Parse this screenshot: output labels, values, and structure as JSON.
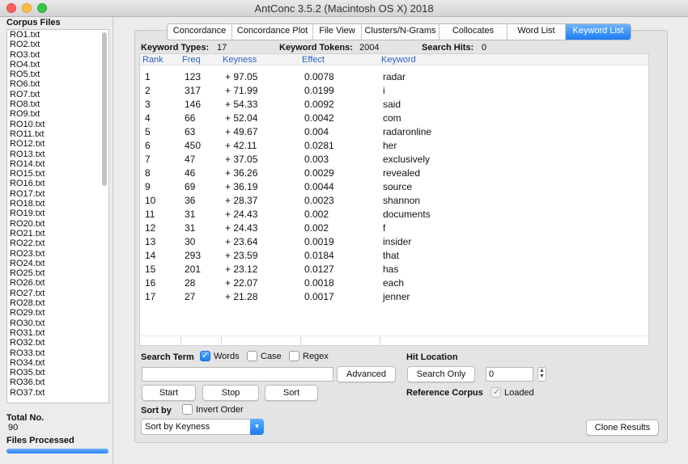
{
  "window": {
    "title": "AntConc 3.5.2 (Macintosh OS X) 2018"
  },
  "sidebar": {
    "corpus_heading": "Corpus Files",
    "files": [
      "RO1.txt",
      "RO2.txt",
      "RO3.txt",
      "RO4.txt",
      "RO5.txt",
      "RO6.txt",
      "RO7.txt",
      "RO8.txt",
      "RO9.txt",
      "RO10.txt",
      "RO11.txt",
      "RO12.txt",
      "RO13.txt",
      "RO14.txt",
      "RO15.txt",
      "RO16.txt",
      "RO17.txt",
      "RO18.txt",
      "RO19.txt",
      "RO20.txt",
      "RO21.txt",
      "RO22.txt",
      "RO23.txt",
      "RO24.txt",
      "RO25.txt",
      "RO26.txt",
      "RO27.txt",
      "RO28.txt",
      "RO29.txt",
      "RO30.txt",
      "RO31.txt",
      "RO32.txt",
      "RO33.txt",
      "RO34.txt",
      "RO35.txt",
      "RO36.txt",
      "RO37.txt"
    ],
    "total_label": "Total No.",
    "total_value": "90",
    "processed_label": "Files Processed",
    "progress_fraction": 1.0
  },
  "tabs": [
    {
      "label": "Concordance",
      "active": false
    },
    {
      "label": "Concordance Plot",
      "active": false
    },
    {
      "label": "File View",
      "active": false
    },
    {
      "label": "Clusters/N-Grams",
      "active": false
    },
    {
      "label": "Collocates",
      "active": false
    },
    {
      "label": "Word List",
      "active": false
    },
    {
      "label": "Keyword List",
      "active": true
    }
  ],
  "stats": {
    "types_label": "Keyword Types:",
    "types_value": "17",
    "tokens_label": "Keyword Tokens:",
    "tokens_value": "2004",
    "hits_label": "Search Hits:",
    "hits_value": "0"
  },
  "table": {
    "headers": {
      "rank": "Rank",
      "freq": "Freq",
      "keyness": "Keyness",
      "effect": "Effect",
      "keyword": "Keyword"
    },
    "rows": [
      {
        "rank": "1",
        "freq": "123",
        "keyness": "+ 97.05",
        "effect": "0.0078",
        "keyword": "radar"
      },
      {
        "rank": "2",
        "freq": "317",
        "keyness": "+ 71.99",
        "effect": "0.0199",
        "keyword": "i"
      },
      {
        "rank": "3",
        "freq": "146",
        "keyness": "+ 54.33",
        "effect": "0.0092",
        "keyword": "said"
      },
      {
        "rank": "4",
        "freq": "66",
        "keyness": "+ 52.04",
        "effect": "0.0042",
        "keyword": "com"
      },
      {
        "rank": "5",
        "freq": "63",
        "keyness": "+ 49.67",
        "effect": "0.004",
        "keyword": "radaronline"
      },
      {
        "rank": "6",
        "freq": "450",
        "keyness": "+ 42.11",
        "effect": "0.0281",
        "keyword": "her"
      },
      {
        "rank": "7",
        "freq": "47",
        "keyness": "+ 37.05",
        "effect": "0.003",
        "keyword": "exclusively"
      },
      {
        "rank": "8",
        "freq": "46",
        "keyness": "+ 36.26",
        "effect": "0.0029",
        "keyword": "revealed"
      },
      {
        "rank": "9",
        "freq": "69",
        "keyness": "+ 36.19",
        "effect": "0.0044",
        "keyword": "source"
      },
      {
        "rank": "10",
        "freq": "36",
        "keyness": "+ 28.37",
        "effect": "0.0023",
        "keyword": "shannon"
      },
      {
        "rank": "11",
        "freq": "31",
        "keyness": "+ 24.43",
        "effect": "0.002",
        "keyword": "documents"
      },
      {
        "rank": "12",
        "freq": "31",
        "keyness": "+ 24.43",
        "effect": "0.002",
        "keyword": "f"
      },
      {
        "rank": "13",
        "freq": "30",
        "keyness": "+ 23.64",
        "effect": "0.0019",
        "keyword": "insider"
      },
      {
        "rank": "14",
        "freq": "293",
        "keyness": "+ 23.59",
        "effect": "0.0184",
        "keyword": "that"
      },
      {
        "rank": "15",
        "freq": "201",
        "keyness": "+ 23.12",
        "effect": "0.0127",
        "keyword": "has"
      },
      {
        "rank": "16",
        "freq": "28",
        "keyness": "+ 22.07",
        "effect": "0.0018",
        "keyword": "each"
      },
      {
        "rank": "17",
        "freq": "27",
        "keyness": "+ 21.28",
        "effect": "0.0017",
        "keyword": "jenner"
      }
    ]
  },
  "search": {
    "label": "Search Term",
    "words_label": "Words",
    "words_checked": true,
    "case_label": "Case",
    "case_checked": false,
    "regex_label": "Regex",
    "regex_checked": false,
    "input_value": "",
    "advanced_label": "Advanced",
    "start_label": "Start",
    "stop_label": "Stop",
    "sort_label": "Sort"
  },
  "hit_location": {
    "label": "Hit Location",
    "search_only_label": "Search Only",
    "value": "0"
  },
  "reference": {
    "label": "Reference Corpus",
    "loaded_label": "Loaded",
    "loaded_checked": true
  },
  "sort": {
    "label": "Sort by",
    "invert_label": "Invert Order",
    "invert_checked": false,
    "selected": "Sort by Keyness"
  },
  "clone_label": "Clone Results"
}
